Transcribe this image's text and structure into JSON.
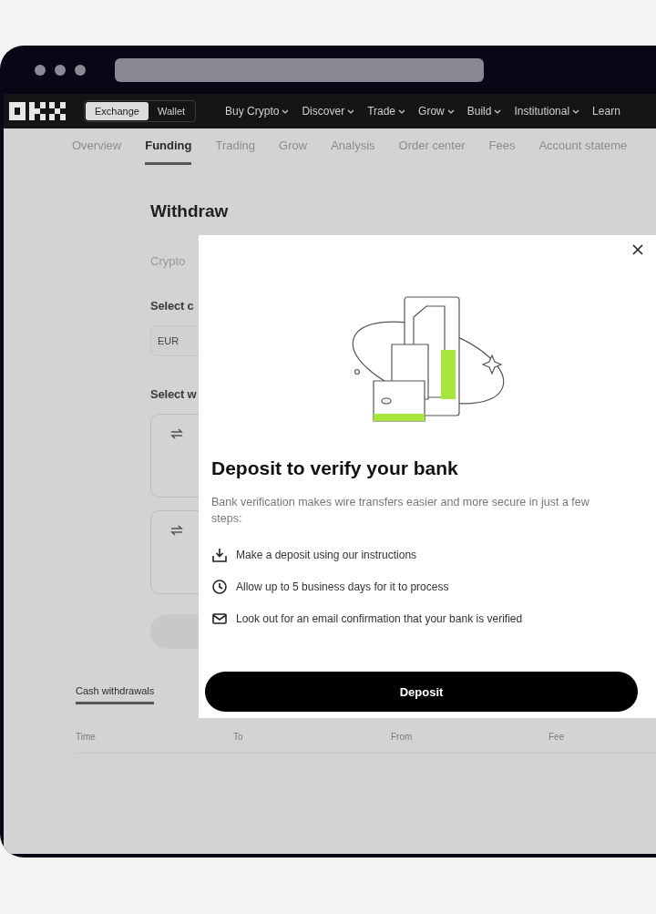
{
  "nav": {
    "toggle": [
      {
        "label": "Exchange",
        "selected": true
      },
      {
        "label": "Wallet",
        "selected": false
      }
    ],
    "items": [
      {
        "label": "Buy Crypto",
        "dropdown": true
      },
      {
        "label": "Discover",
        "dropdown": true
      },
      {
        "label": "Trade",
        "dropdown": true
      },
      {
        "label": "Grow",
        "dropdown": true
      },
      {
        "label": "Build",
        "dropdown": true
      },
      {
        "label": "Institutional",
        "dropdown": true
      },
      {
        "label": "Learn",
        "dropdown": false
      }
    ]
  },
  "subnav": [
    {
      "label": "Overview",
      "selected": false
    },
    {
      "label": "Funding",
      "selected": true
    },
    {
      "label": "Trading",
      "selected": false
    },
    {
      "label": "Grow",
      "selected": false
    },
    {
      "label": "Analysis",
      "selected": false
    },
    {
      "label": "Order center",
      "selected": false
    },
    {
      "label": "Fees",
      "selected": false
    },
    {
      "label": "Account stateme",
      "selected": false
    }
  ],
  "withdraw": {
    "title": "Withdraw",
    "tab": "Crypto",
    "currency_label": "Select c",
    "currency_value": "EUR",
    "method_label": "Select w"
  },
  "history": {
    "tabs": [
      {
        "label": "Cash withdrawals",
        "selected": true
      }
    ],
    "columns": [
      "Time",
      "To",
      "From",
      "Fee"
    ]
  },
  "modal": {
    "title": "Deposit to verify your bank",
    "description": "Bank verification makes wire transfers easier and more secure in just a few steps:",
    "steps": [
      {
        "kind": "download",
        "text": "Make a deposit using our instructions"
      },
      {
        "kind": "clock",
        "text": "Allow up to 5 business days for it to process"
      },
      {
        "kind": "mail",
        "text": "Look out for an email confirmation that your bank is verified"
      }
    ],
    "button": "Deposit"
  }
}
